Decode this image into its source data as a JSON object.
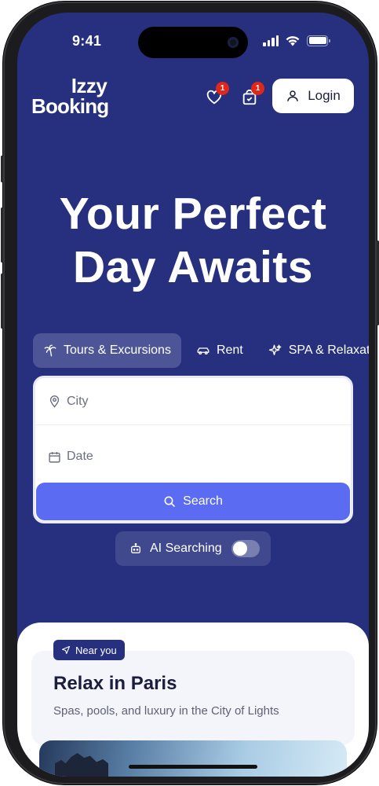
{
  "status_bar": {
    "time": "9:41"
  },
  "header": {
    "logo_line1": "Izzy",
    "logo_line2": "Booking",
    "favorites_badge": "1",
    "cart_badge": "1",
    "login_label": "Login"
  },
  "hero": {
    "line1": "Your Perfect",
    "line2": "Day Awaits"
  },
  "categories": [
    {
      "label": "Tours & Excursions",
      "icon": "palm-tree-icon",
      "active": true
    },
    {
      "label": "Rent",
      "icon": "car-icon",
      "active": false
    },
    {
      "label": "SPA & Relaxation",
      "icon": "sparkle-icon",
      "active": false
    }
  ],
  "search": {
    "city_placeholder": "City",
    "date_placeholder": "Date",
    "button_label": "Search"
  },
  "ai_searching": {
    "label": "AI Searching",
    "enabled": false
  },
  "featured": {
    "chip": "Near you",
    "title": "Relax in Paris",
    "subtitle": "Spas, pools, and luxury in the City of Lights"
  },
  "colors": {
    "brand_navy": "#26307f",
    "accent_blue": "#5b6cf2",
    "badge_red": "#e1261c"
  }
}
